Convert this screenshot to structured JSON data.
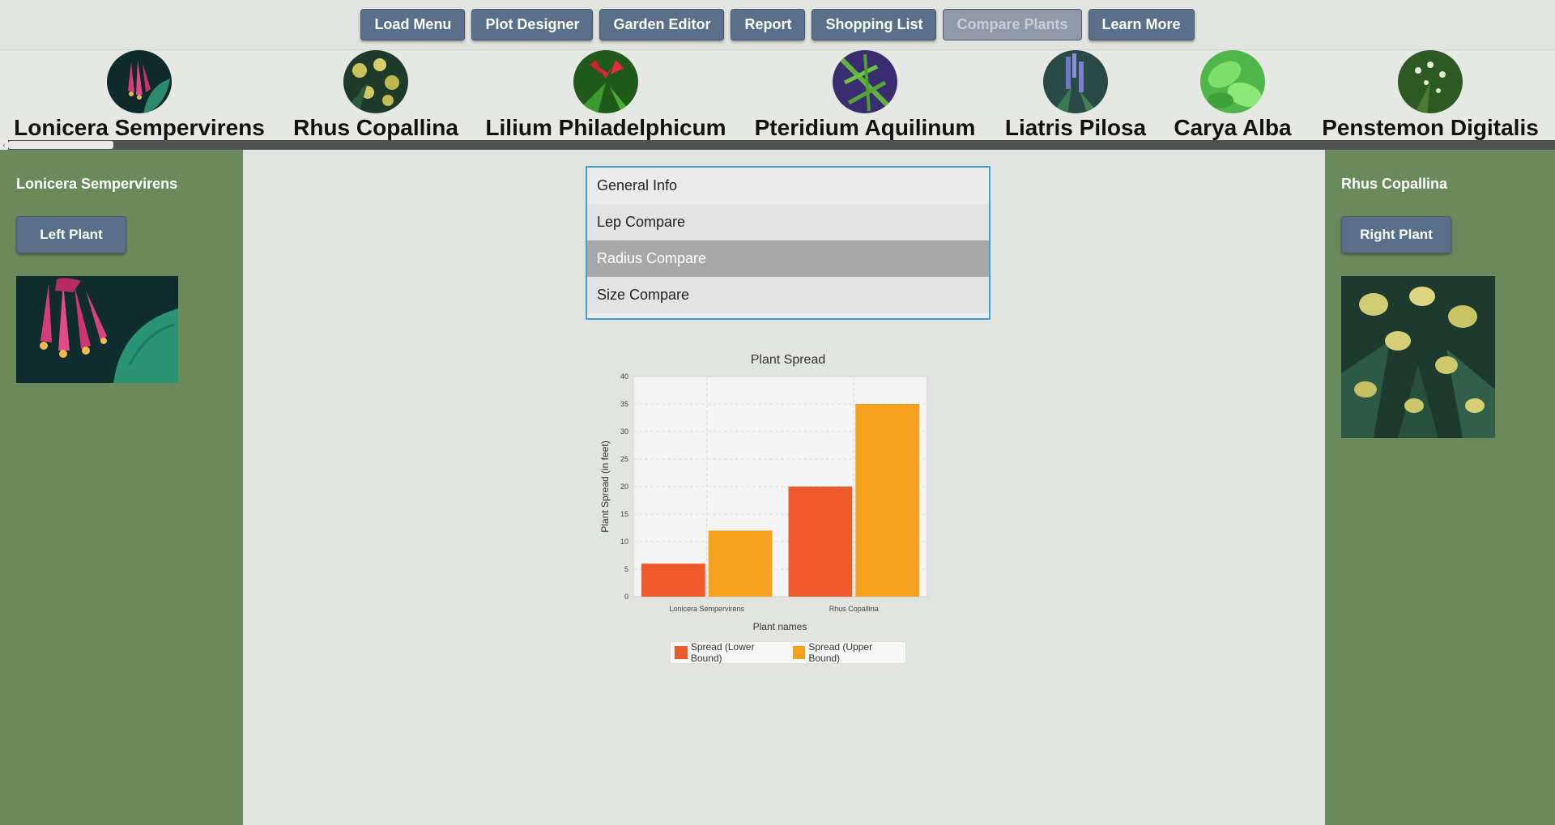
{
  "nav": {
    "buttons": [
      {
        "label": "Load Menu",
        "disabled": false
      },
      {
        "label": "Plot Designer",
        "disabled": false
      },
      {
        "label": "Garden Editor",
        "disabled": false
      },
      {
        "label": "Report",
        "disabled": false
      },
      {
        "label": "Shopping List",
        "disabled": false
      },
      {
        "label": "Compare Plants",
        "disabled": true
      },
      {
        "label": "Learn More",
        "disabled": false
      }
    ]
  },
  "plants": [
    {
      "name": "Lonicera Sempervirens"
    },
    {
      "name": "Rhus Copallina"
    },
    {
      "name": "Lilium Philadelphicum"
    },
    {
      "name": "Pteridium Aquilinum"
    },
    {
      "name": "Liatris Pilosa"
    },
    {
      "name": "Carya Alba"
    },
    {
      "name": "Penstemon Digitalis"
    }
  ],
  "left_panel": {
    "title": "Lonicera Sempervirens",
    "button": "Left Plant"
  },
  "right_panel": {
    "title": "Rhus Copallina",
    "button": "Right Plant"
  },
  "compare_list": {
    "items": [
      "General Info",
      "Lep Compare",
      "Radius Compare",
      "Size Compare"
    ],
    "selected": "Radius Compare"
  },
  "chart_data": {
    "type": "bar",
    "title": "Plant Spread",
    "xlabel": "Plant names",
    "ylabel": "Plant Spread (in feet)",
    "categories": [
      "Lonicera Sempervirens",
      "Rhus Copallina"
    ],
    "series": [
      {
        "name": "Spread (Lower Bound)",
        "values": [
          6,
          20
        ],
        "color": "#ee5a2b"
      },
      {
        "name": "Spread (Upper Bound)",
        "values": [
          12,
          35
        ],
        "color": "#f5a11d"
      }
    ],
    "ylim": [
      0,
      40
    ],
    "yticks": [
      0,
      5,
      10,
      15,
      20,
      25,
      30,
      35,
      40
    ],
    "grid": true,
    "legend_position": "bottom"
  }
}
